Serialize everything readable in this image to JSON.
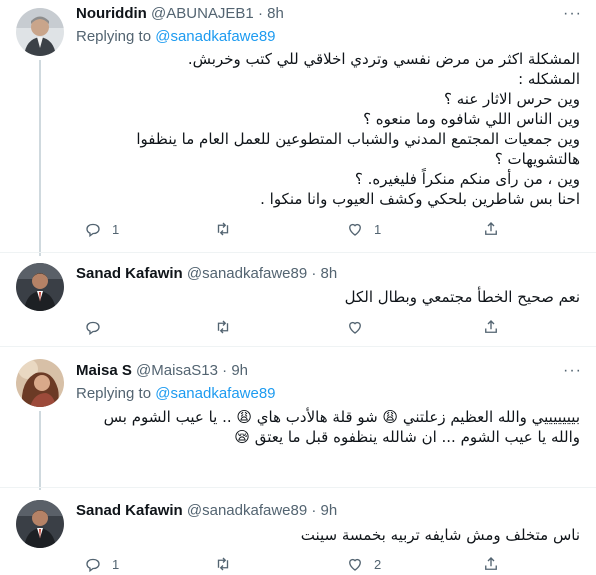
{
  "tweets": [
    {
      "name": "Nouriddin",
      "handle": "@ABUNAJEB1",
      "time": "8h",
      "replying_label": "Replying to",
      "replying_to": "@sanadkafawe89",
      "lines": [
        "المشكلة اكثر من مرض نفسي وتردي اخلاقي للي كتب وخربش.",
        "المشكله :",
        "وين حرس الاثار عنه ؟",
        "وين الناس اللي شافوه وما منعوه ؟",
        "وين جمعيات المجتمع المدني والشباب المتطوعين للعمل العام ما ينظفوا",
        "هالتشويهات ؟",
        "وين ، من رأى منكم منكراً فليغيره. ؟",
        "احنا بس شاطرين بلحكي وكشف العيوب وانا منكوا ."
      ],
      "replies": "1",
      "retweets": "",
      "likes": "1"
    },
    {
      "name": "Sanad Kafawin",
      "handle": "@sanadkafawe89",
      "time": "8h",
      "lines": [
        "نعم صحيح الخطأ مجتمعي وبطال الكل"
      ],
      "replies": "",
      "retweets": "",
      "likes": ""
    },
    {
      "name": "Maisa S",
      "handle": "@MaisaS13",
      "time": "9h",
      "replying_label": "Replying to",
      "replying_to": "@sanadkafawe89",
      "lines": [
        "بيييييييي والله العظيم زعلتني 😩 شو قلة هالأدب هاي 😩 .. يا عيب الشوم بس",
        "والله يا عيب الشوم ... ان شالله ينظفوه قبل ما يعتق 😪"
      ],
      "replies": "",
      "retweets": "",
      "likes": ""
    },
    {
      "name": "Sanad Kafawin",
      "handle": "@sanadkafawe89",
      "time": "9h",
      "lines": [
        "ناس متخلف ومش شايفه تربيه بخمسة سينت"
      ],
      "replies": "1",
      "retweets": "",
      "likes": "2"
    }
  ],
  "more_label": "···",
  "dot": "·",
  "colors": {
    "link": "#1d9bf0",
    "muted": "#536471",
    "text": "#0f1419"
  }
}
